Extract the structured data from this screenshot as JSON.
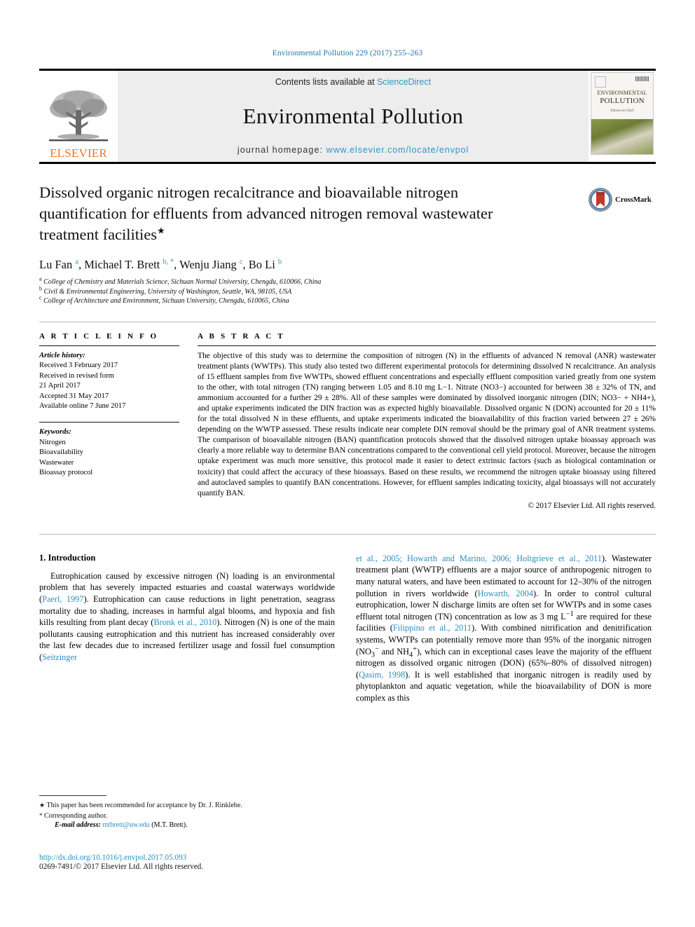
{
  "running_head": "Environmental Pollution 229 (2017) 255–263",
  "masthead": {
    "publisher_name": "ELSEVIER",
    "contents_prefix": "Contents lists available at ",
    "contents_link": "ScienceDirect",
    "journal_title": "Environmental Pollution",
    "homepage_prefix": "journal homepage: ",
    "homepage_url": "www.elsevier.com/locate/envpol",
    "cover": {
      "line1": "ENVIRONMENTAL",
      "line2": "POLLUTION",
      "sub": "Editors-in-Chief"
    }
  },
  "article": {
    "title": "Dissolved organic nitrogen recalcitrance and bioavailable nitrogen quantification for effluents from advanced nitrogen removal wastewater treatment facilities",
    "title_mark": "★",
    "crossmark_label": "CrossMark",
    "authors_html": "Lu Fan <sup>a</sup>, Michael T. Brett <sup>b, *</sup>, Wenju Jiang <sup>c</sup>, Bo Li <sup>b</sup>",
    "affiliations": [
      {
        "mark": "a",
        "text": "College of Chemistry and Materials Science, Sichuan Normal University, Chengdu, 610066, China"
      },
      {
        "mark": "b",
        "text": "Civil & Environmental Engineering, University of Washington, Seattle, WA, 98105, USA"
      },
      {
        "mark": "c",
        "text": "College of Architecture and Environment, Sichuan University, Chengdu, 610065, China"
      }
    ]
  },
  "article_info": {
    "heading": "A R T I C L E  I N F O",
    "history_label": "Article history:",
    "history": [
      "Received 3 February 2017",
      "Received in revised form",
      "21 April 2017",
      "Accepted 31 May 2017",
      "Available online 7 June 2017"
    ],
    "keywords_label": "Keywords:",
    "keywords": [
      "Nitrogen",
      "Bioavailability",
      "Wastewater",
      "Bioassay protocol"
    ]
  },
  "abstract": {
    "heading": "A B S T R A C T",
    "text": "The objective of this study was to determine the composition of nitrogen (N) in the effluents of advanced N removal (ANR) wastewater treatment plants (WWTPs). This study also tested two different experimental protocols for determining dissolved N recalcitrance. An analysis of 15 effluent samples from five WWTPs, showed effluent concentrations and especially effluent composition varied greatly from one system to the other, with total nitrogen (TN) ranging between 1.05 and 8.10 mg L−1. Nitrate (NO3−) accounted for between 38 ± 32% of TN, and ammonium accounted for a further 29 ± 28%. All of these samples were dominated by dissolved inorganic nitrogen (DIN; NO3− + NH4+), and uptake experiments indicated the DIN fraction was as expected highly bioavailable. Dissolved organic N (DON) accounted for 20 ± 11% for the total dissolved N in these effluents, and uptake experiments indicated the bioavailability of this fraction varied between 27 ± 26% depending on the WWTP assessed. These results indicate near complete DIN removal should be the primary goal of ANR treatment systems. The comparison of bioavailable nitrogen (BAN) quantification protocols showed that the dissolved nitrogen uptake bioassay approach was clearly a more reliable way to determine BAN concentrations compared to the conventional cell yield protocol. Moreover, because the nitrogen uptake experiment was much more sensitive, this protocol made it easier to detect extrinsic factors (such as biological contamination or toxicity) that could affect the accuracy of these bioassays. Based on these results, we recommend the nitrogen uptake bioassay using filtered and autoclaved samples to quantify BAN concentrations. However, for effluent samples indicating toxicity, algal bioassays will not accurately quantify BAN.",
    "copyright": "© 2017 Elsevier Ltd. All rights reserved."
  },
  "body": {
    "section_heading": "1. Introduction",
    "left_paragraph_html": "Eutrophication caused by excessive nitrogen (N) loading is an environmental problem that has severely impacted estuaries and coastal waterways worldwide (<span class=\"ref\">Paerl, 1997</span>). Eutrophication can cause reductions in light penetration, seagrass mortality due to shading, increases in harmful algal blooms, and hypoxia and fish kills resulting from plant decay (<span class=\"ref\">Bronk et al., 2010</span>). Nitrogen (N) is one of the main pollutants causing eutrophication and this nutrient has increased considerably over the last few decades due to increased fertilizer usage and fossil fuel consumption (<span class=\"ref\">Seitzinger</span>",
    "right_paragraph_html": "<span class=\"ref\">et al., 2005; Howarth and Marino, 2006; Holtgrieve et al., 2011</span>). Wastewater treatment plant (WWTP) effluents are a major source of anthropogenic nitrogen to many natural waters, and have been estimated to account for 12–30% of the nitrogen pollution in rivers worldwide (<span class=\"ref\">Howarth, 2004</span>). In order to control cultural eutrophication, lower N discharge limits are often set for WWTPs and in some cases effluent total nitrogen (TN) concentration as low as 3 mg L<sup>−1</sup> are required for these facilities (<span class=\"ref\">Filippino et al., 2011</span>). With combined nitrification and denitrification systems, WWTPs can potentially remove more than 95% of the inorganic nitrogen (NO<sub>3</sub><sup>−</sup> and NH<sub>4</sub><sup>+</sup>), which can in exceptional cases leave the majority of the effluent nitrogen as dissolved organic nitrogen (DON) (65%–80% of dissolved nitrogen) (<span class=\"ref\">Qasim, 1998</span>). It is well established that inorganic nitrogen is readily used by phytoplankton and aquatic vegetation, while the bioavailability of DON is more complex as this"
  },
  "footnotes": {
    "note_star_mark": "★",
    "note_star": "This paper has been recommended for acceptance by Dr. J. Rinklebe.",
    "note_corr_mark": "*",
    "note_corr": "Corresponding author.",
    "email_label": "E-mail address:",
    "email": "mtbrett@uw.edu",
    "email_suffix": "(M.T. Brett)."
  },
  "footer": {
    "doi": "http://dx.doi.org/10.1016/j.envpol.2017.05.093",
    "issn_line": "0269-7491/© 2017 Elsevier Ltd. All rights reserved."
  },
  "colors": {
    "link_blue": "#2a8fc0",
    "elsevier_orange": "#E87722",
    "band_gray": "#ededed"
  }
}
